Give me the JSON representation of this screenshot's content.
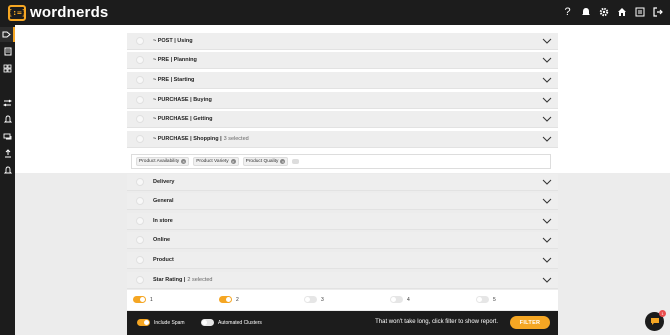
{
  "app": {
    "brand": "wordnerds",
    "logo_glyph": "{:=}"
  },
  "topbar_icons": [
    "help-icon",
    "bell-icon",
    "gear-icon",
    "home-icon",
    "swap-icon",
    "logout-icon"
  ],
  "sidebar_icons": [
    "tag-icon",
    "document-icon",
    "grid-icon",
    "shuffle-icon",
    "bell-icon",
    "chat-icon",
    "upload-icon",
    "alert-icon"
  ],
  "rows": [
    {
      "label": "~ POST | Using",
      "sub": ""
    },
    {
      "label": "~ PRE | Planning",
      "sub": ""
    },
    {
      "label": "~ PRE | Starting",
      "sub": ""
    },
    {
      "label": "~ PURCHASE | Buying",
      "sub": ""
    },
    {
      "label": "~ PURCHASE | Getting",
      "sub": ""
    },
    {
      "label": "~ PURCHASE | Shopping |",
      "sub": "3 selected"
    },
    {
      "label": "Delivery",
      "sub": ""
    },
    {
      "label": "General",
      "sub": ""
    },
    {
      "label": "In store",
      "sub": ""
    },
    {
      "label": "Online",
      "sub": ""
    },
    {
      "label": "Product",
      "sub": ""
    },
    {
      "label": "Star Rating |",
      "sub": "2 selected"
    }
  ],
  "tags": [
    "Product Availability",
    "Product Variety",
    "Product Quality"
  ],
  "star_options": [
    {
      "label": "1",
      "on": true
    },
    {
      "label": "2",
      "on": true
    },
    {
      "label": "3",
      "on": false
    },
    {
      "label": "4",
      "on": false
    },
    {
      "label": "5",
      "on": false
    }
  ],
  "footer": {
    "include_spam": "Include Spam",
    "include_spam_on": true,
    "automated_clusters": "Automated Clusters",
    "automated_clusters_on": false,
    "message": "That won't take long, click filter to show report.",
    "filter_label": "FILTER"
  },
  "chat_badge": "1",
  "colors": {
    "accent": "#f5a623",
    "dark": "#1c1c1c"
  }
}
